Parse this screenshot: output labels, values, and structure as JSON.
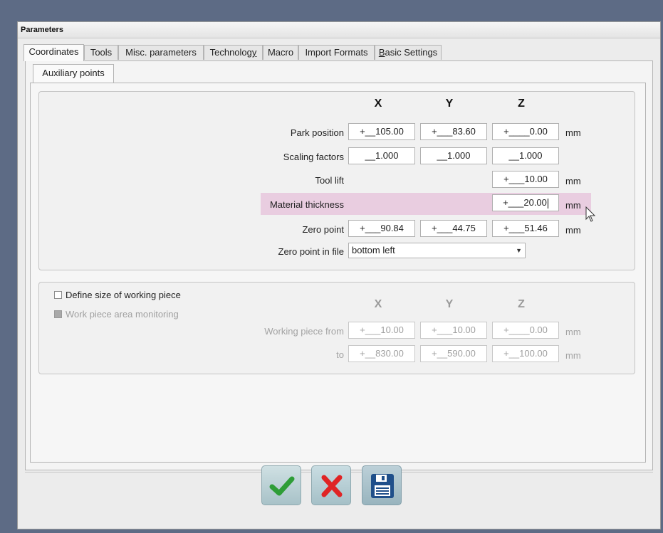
{
  "window": {
    "title": "Parameters"
  },
  "tabs": [
    {
      "label": "Coordinates",
      "active": true
    },
    {
      "label": "Tools"
    },
    {
      "label": "Misc. parameters"
    },
    {
      "label": "Technology"
    },
    {
      "label": "Macro"
    },
    {
      "label": "Import Formats"
    },
    {
      "label": "Basic Settings"
    }
  ],
  "subtab": {
    "label": "Auxiliary points"
  },
  "aux": {
    "axes": {
      "x": "X",
      "y": "Y",
      "z": "Z"
    },
    "park_position": {
      "label": "Park position",
      "x": "+__105.00",
      "y": "+___83.60",
      "z": "+____0.00",
      "unit": "mm"
    },
    "scaling_factors": {
      "label": "Scaling factors",
      "x": "__1.000",
      "y": "__1.000",
      "z": "__1.000"
    },
    "tool_lift": {
      "label": "Tool lift",
      "z": "+___10.00",
      "unit": "mm"
    },
    "material_thickness": {
      "label": "Material thickness",
      "z": "+___20.00",
      "unit": "mm",
      "highlight_color": "#e9cde0"
    },
    "zero_point": {
      "label": "Zero point",
      "x": "+___90.84",
      "y": "+___44.75",
      "z": "+___51.46",
      "unit": "mm"
    },
    "zero_point_in_file": {
      "label": "Zero point in file",
      "value": "bottom left"
    }
  },
  "workpiece": {
    "define_size": {
      "label": "Define size of working piece",
      "checked": false
    },
    "area_monitoring": {
      "label": "Work piece area monitoring",
      "checked": false,
      "disabled": true
    },
    "axes": {
      "x": "X",
      "y": "Y",
      "z": "Z"
    },
    "from": {
      "label": "Working piece from",
      "x": "+___10.00",
      "y": "+___10.00",
      "z": "+____0.00",
      "unit": "mm"
    },
    "to": {
      "label": "to",
      "x": "+__830.00",
      "y": "+__590.00",
      "z": "+__100.00",
      "unit": "mm"
    }
  },
  "buttons": {
    "ok": {
      "icon": "checkmark-icon",
      "color": "#2e9d37"
    },
    "cancel": {
      "icon": "x-icon",
      "color": "#e02424"
    },
    "save": {
      "icon": "floppy-disk-icon",
      "color": "#1f4f8a"
    }
  }
}
